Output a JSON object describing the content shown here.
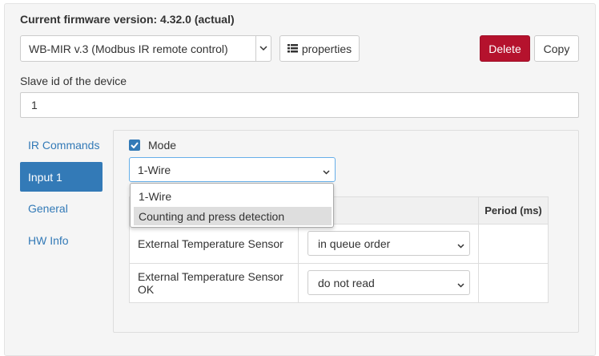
{
  "firmware": {
    "title": "Current firmware version: 4.32.0 (actual)"
  },
  "device": {
    "selected": "WB-MIR v.3 (Modbus IR remote control)",
    "properties_label": "properties",
    "delete_label": "Delete",
    "copy_label": "Copy"
  },
  "slave": {
    "label": "Slave id of the device",
    "value": "1"
  },
  "nav": {
    "items": [
      {
        "label": "IR Commands",
        "active": false
      },
      {
        "label": "Input 1",
        "active": true
      },
      {
        "label": "General",
        "active": false
      },
      {
        "label": "HW Info",
        "active": false
      }
    ]
  },
  "mode": {
    "label": "Mode",
    "checked": true,
    "selected": "1-Wire",
    "options": [
      "1-Wire",
      "Counting and press detection"
    ],
    "highlighted": "Counting and press detection"
  },
  "table": {
    "header_period": "Period (ms)",
    "rows": [
      {
        "name": "External Temperature Sensor",
        "mode": "in queue order"
      },
      {
        "name": "External Temperature Sensor OK",
        "mode": "do not read"
      }
    ]
  },
  "colors": {
    "primary": "#337ab7",
    "danger": "#b5122d"
  },
  "icons": {
    "caret": "chevron-down-icon",
    "properties": "list-icon",
    "check": "check-icon"
  }
}
